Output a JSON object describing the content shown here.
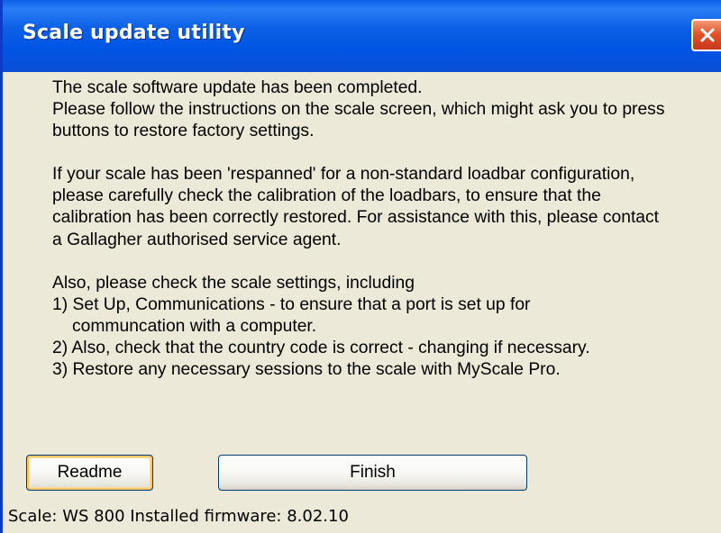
{
  "window": {
    "title": "Scale update utility",
    "close_icon": "close-icon"
  },
  "message": {
    "paragraph1": [
      "The scale software update has been completed.",
      "Please follow the instructions on the scale screen, which might ask you to press",
      "buttons to restore factory settings."
    ],
    "paragraph2": [
      "If your scale has been 'respanned' for a non-standard loadbar configuration,",
      "please carefully check the calibration of the loadbars, to ensure that the",
      "calibration has been correctly restored. For assistance with this, please contact",
      "a Gallagher authorised service agent."
    ],
    "paragraph3": [
      "Also, please check the scale settings, including",
      "1) Set Up, Communications - to ensure that a port is set up for",
      "communcation with a computer.",
      "2) Also, check that the country code is correct - changing if necessary.",
      "3) Restore any necessary sessions to the scale with MyScale Pro."
    ]
  },
  "buttons": {
    "readme": "Readme",
    "finish": "Finish"
  },
  "status": {
    "text": "Scale: WS 800 Installed firmware: 8.02.10"
  },
  "colors": {
    "titlebar": "#0054e3",
    "dialog_bg": "#ece9d8",
    "close_button": "#e2542a"
  }
}
